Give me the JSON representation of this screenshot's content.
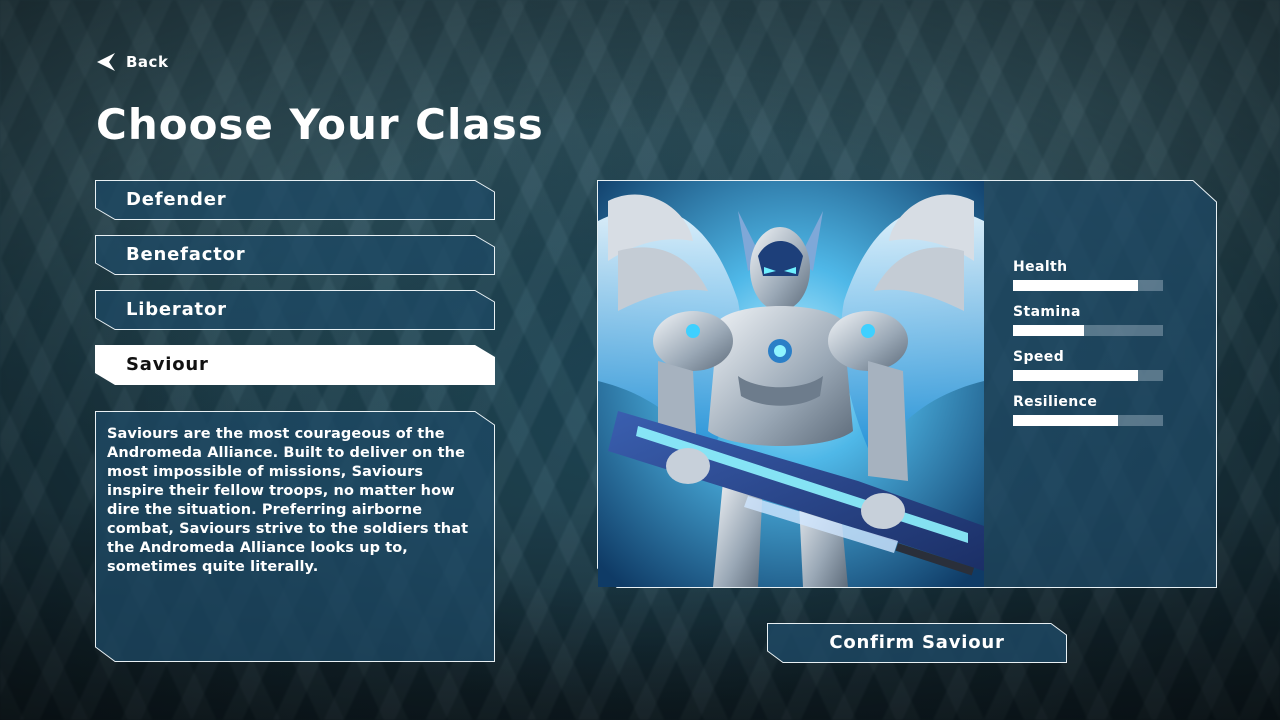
{
  "back": {
    "label": "Back",
    "icon": "back-arrow-icon"
  },
  "title": "Choose Your Class",
  "classes": [
    {
      "label": "Defender",
      "selected": false
    },
    {
      "label": "Benefactor",
      "selected": false
    },
    {
      "label": "Liberator",
      "selected": false
    },
    {
      "label": "Saviour",
      "selected": true
    }
  ],
  "description": "Saviours are the most courageous of the Andromeda Alliance. Built to deliver on the most impossible of missions, Saviours inspire their fellow troops, no matter how dire the situation. Preferring airborne combat, Saviours strive to the soldiers that the Andromeda Alliance looks up to, sometimes quite literally.",
  "stats": [
    {
      "label": "Health",
      "value": 0.83
    },
    {
      "label": "Stamina",
      "value": 0.47
    },
    {
      "label": "Speed",
      "value": 0.83
    },
    {
      "label": "Resilience",
      "value": 0.7
    }
  ],
  "confirm_label": "Confirm Saviour",
  "colors": {
    "panel_fill": "#1e4a66",
    "panel_stroke": "#e8f0f4",
    "selected_fill": "#ffffff",
    "accent_glow": "#3fd0ff"
  }
}
